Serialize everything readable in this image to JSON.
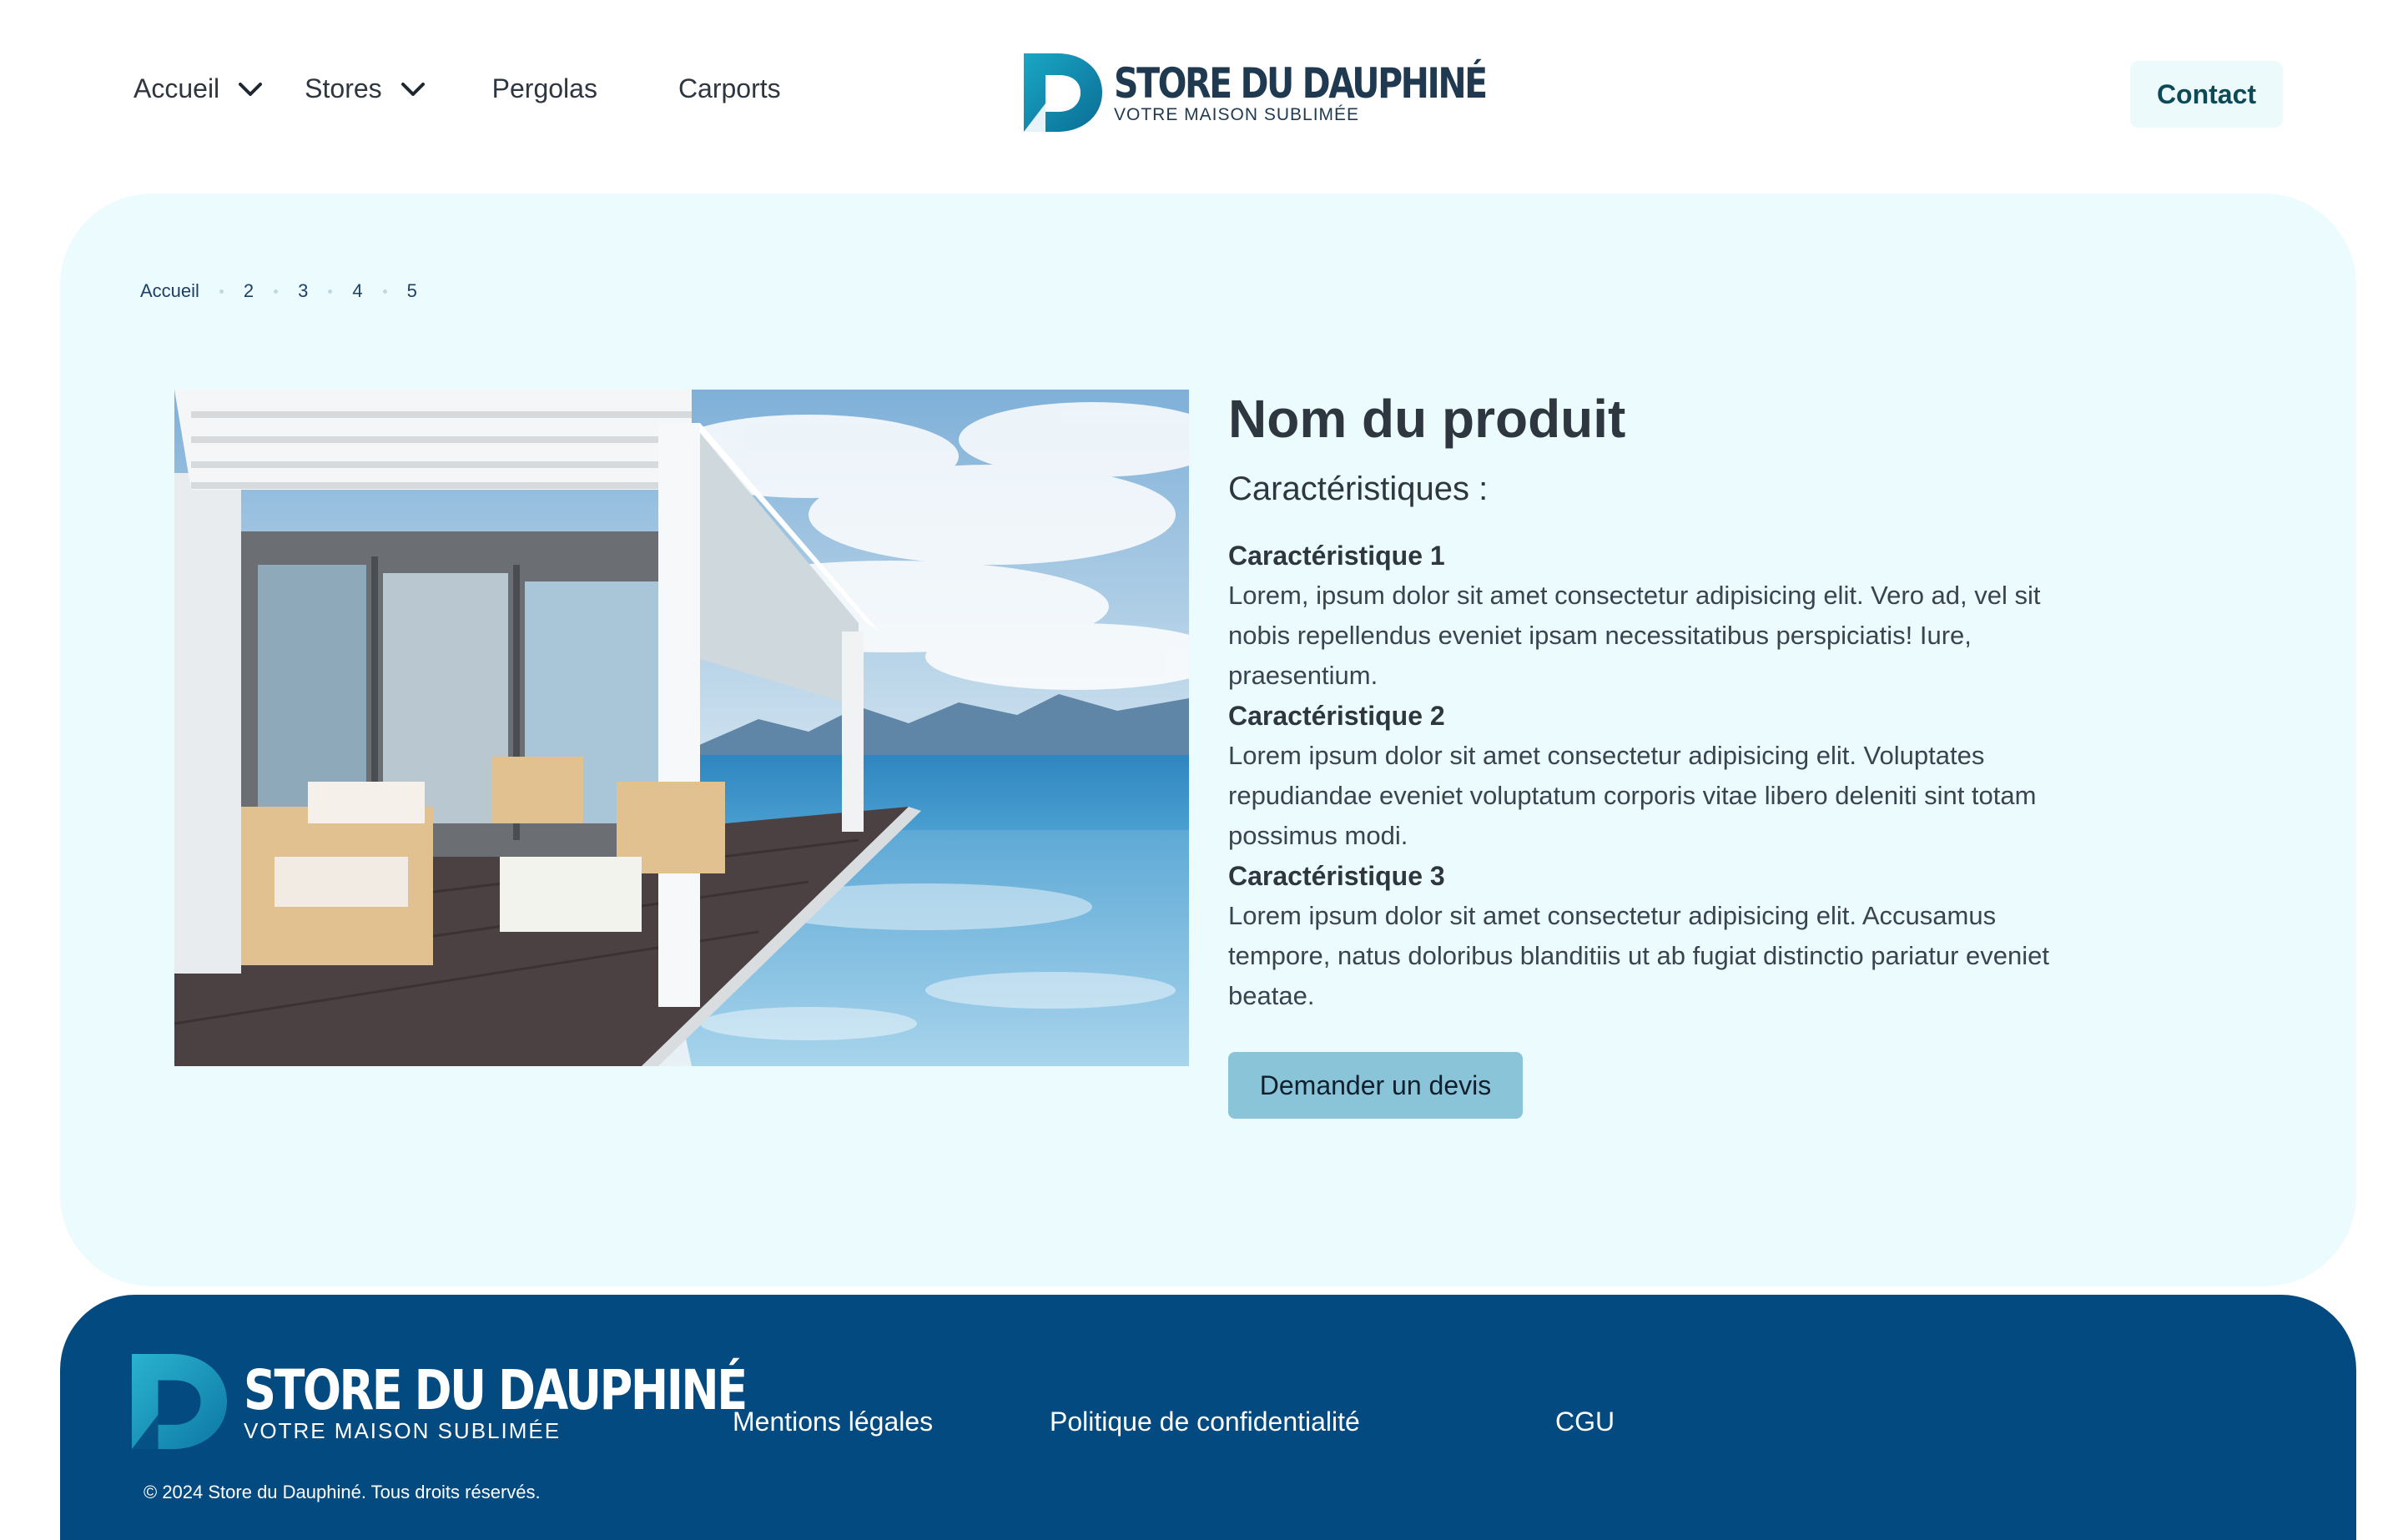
{
  "header": {
    "nav": [
      {
        "label": "Accueil",
        "has_dropdown": true
      },
      {
        "label": "Stores",
        "has_dropdown": true
      },
      {
        "label": "Pergolas",
        "has_dropdown": false
      },
      {
        "label": "Carports",
        "has_dropdown": false
      }
    ],
    "logo": {
      "name": "STORE DU DAUPHINÉ",
      "tagline": "VOTRE MAISON SUBLIMÉE"
    },
    "contact_label": "Contact"
  },
  "breadcrumb": [
    "Accueil",
    "2",
    "3",
    "4",
    "5"
  ],
  "product": {
    "title": "Nom du produit",
    "subtitle": "Caractéristiques :",
    "features": [
      {
        "title": "Caractéristique 1",
        "text": "Lorem, ipsum dolor sit amet consectetur adipisicing elit. Vero ad, vel sit nobis repellendus eveniet ipsam necessitatibus perspiciatis! Iure, praesentium."
      },
      {
        "title": "Caractéristique 2",
        "text": "Lorem ipsum dolor sit amet consectetur adipisicing elit. Voluptates repudiandae eveniet voluptatum corporis vitae libero deleniti sint totam possimus modi."
      },
      {
        "title": "Caractéristique 3",
        "text": "Lorem ipsum dolor sit amet consectetur adipisicing elit. Accusamus tempore, natus doloribus blanditiis ut ab fugiat distinctio pariatur eveniet beatae."
      }
    ],
    "quote_label": "Demander un devis"
  },
  "footer": {
    "logo": {
      "name": "STORE DU DAUPHINÉ",
      "tagline": "VOTRE MAISON SUBLIMÉE"
    },
    "links": [
      "Mentions légales",
      "Politique de confidentialité",
      "CGU"
    ],
    "copyright": "© 2024 Store du Dauphiné. Tous droits réservés."
  },
  "colors": {
    "accent": "#8ac4d8",
    "panel": "#ecfbfd",
    "footer": "#034a80",
    "text": "#2e3640"
  }
}
